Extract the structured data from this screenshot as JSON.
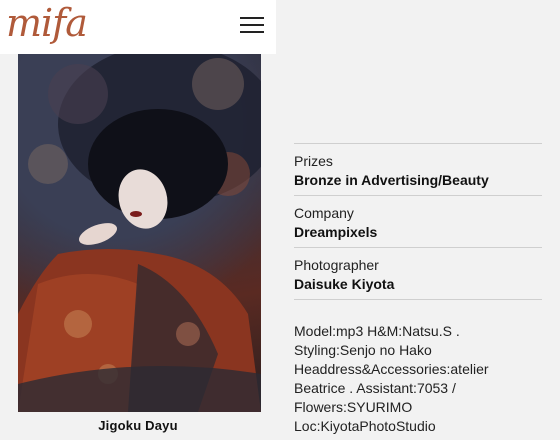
{
  "header": {
    "logo_text": "mifa",
    "menu_icon": "hamburger-menu-icon"
  },
  "photo": {
    "caption": "Jigoku Dayu"
  },
  "details": [
    {
      "label": "Prizes",
      "value": "Bronze in Advertising/Beauty"
    },
    {
      "label": "Company",
      "value": "Dreampixels"
    },
    {
      "label": "Photographer",
      "value": "Daisuke Kiyota"
    }
  ],
  "credits": "Model:mp3 H&M:Natsu.S . Styling:Senjo no Hako Headdress&Accessories:atelier Beatrice . Assistant:7053 / Flowers:SYURIMO Loc:KiyotaPhotoStudio",
  "colors": {
    "logo": "#b05a3a",
    "background": "#f2f2f2",
    "divider": "#cfcfcf"
  }
}
